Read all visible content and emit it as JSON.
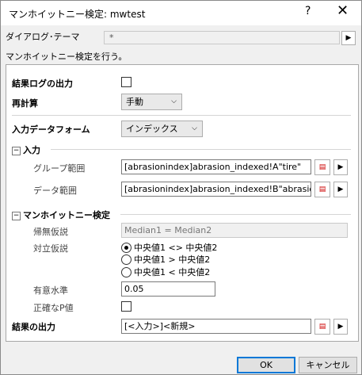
{
  "window": {
    "title": "マンホイットニー検定: mwtest",
    "help": "?",
    "close": "✕"
  },
  "theme": {
    "label": "ダイアログ･テーマ",
    "value": "*",
    "arrow": "▶"
  },
  "description": "マンホイットニー検定を行う。",
  "result_log": {
    "label": "結果ログの出力",
    "checked": false
  },
  "recalc": {
    "label": "再計算",
    "value": "手動",
    "caret": "⌵"
  },
  "input_form": {
    "label": "入力データフォーム",
    "value": "インデックス",
    "caret": "⌵"
  },
  "input_group": {
    "header": "入力",
    "toggle": "−",
    "group_range": {
      "label": "グループ範囲",
      "value": "[abrasionindex]abrasion_indexed!A\"tire\""
    },
    "data_range": {
      "label": "データ範囲",
      "value": "[abrasionindex]abrasion_indexed!B\"abrasion\""
    }
  },
  "test_group": {
    "header": "マンホイットニー検定",
    "toggle": "−",
    "null_hyp": {
      "label": "帰無仮説",
      "value": "Median1 = Median2"
    },
    "alt_hyp": {
      "label": "対立仮説",
      "options": [
        "中央値1 <> 中央値2",
        "中央値1 > 中央値2",
        "中央値1 < 中央値2"
      ],
      "selected": 0
    },
    "significance": {
      "label": "有意水準",
      "value": "0.05"
    },
    "exact_p": {
      "label": "正確なP値",
      "checked": false
    }
  },
  "output": {
    "label": "結果の出力",
    "value": "[<入力>]<新規>"
  },
  "buttons": {
    "ok": "OK",
    "cancel": "キャンセル"
  },
  "icons": {
    "picker": "range-picker-icon",
    "arrow": "▶"
  }
}
